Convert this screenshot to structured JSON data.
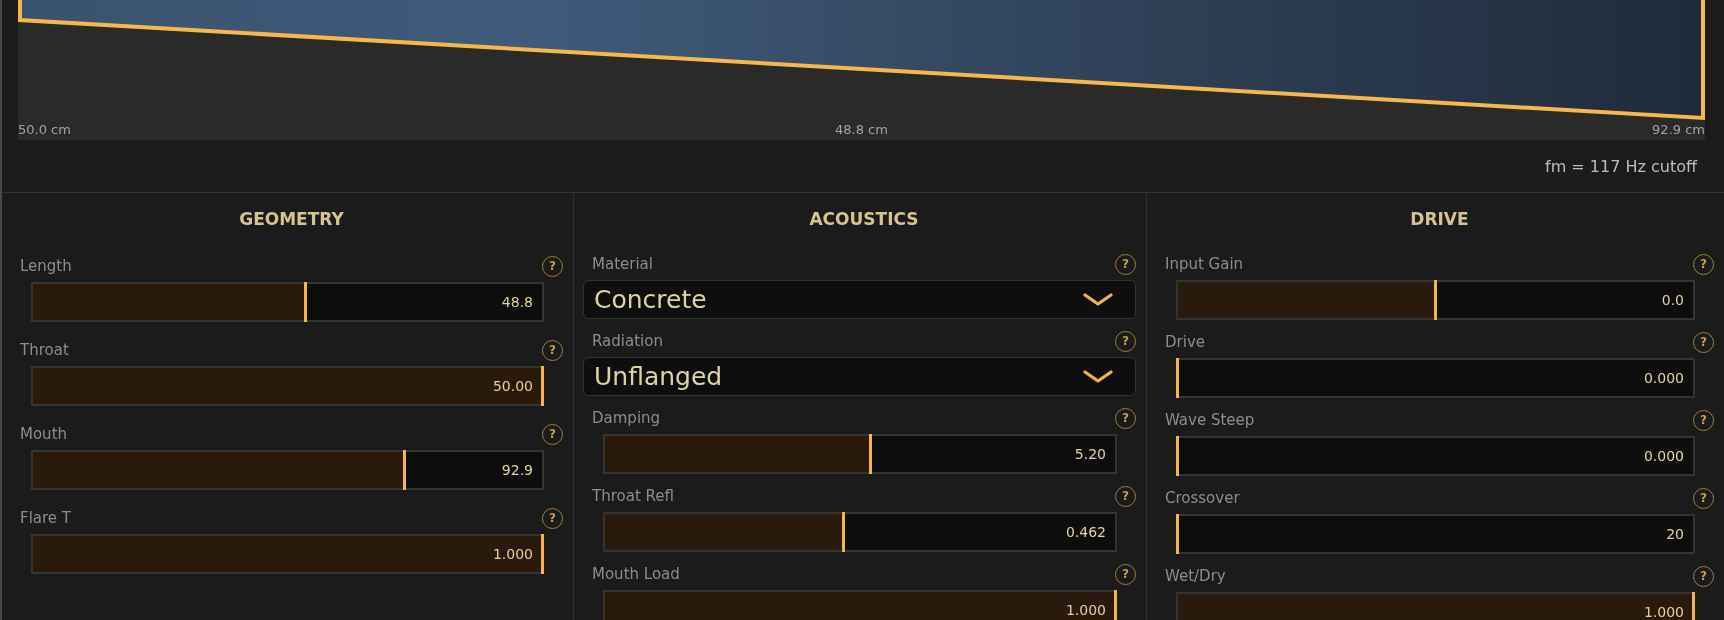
{
  "profile_plot": {
    "scale_labels": [
      "50.0 cm",
      "48.8 cm",
      "92.9 cm"
    ]
  },
  "cutoff_readout": "fm = 117 Hz cutoff",
  "sections": [
    {
      "title": "GEOMETRY",
      "controls": [
        {
          "kind": "slider",
          "label": "Length",
          "help": "?",
          "value": "48.8",
          "level": 0.536
        },
        {
          "kind": "slider",
          "label": "Throat",
          "help": "?",
          "value": "50.00",
          "level": 1
        },
        {
          "kind": "slider",
          "label": "Mouth",
          "help": "?",
          "value": "92.9",
          "level": 0.729
        },
        {
          "kind": "slider",
          "label": "Flare T",
          "help": "?",
          "value": "1.000",
          "level": 1
        }
      ]
    },
    {
      "title": "ACOUSTICS",
      "controls": [
        {
          "kind": "dropdown",
          "label": "Material",
          "help": "?",
          "value": "Concrete"
        },
        {
          "kind": "dropdown",
          "label": "Radiation",
          "help": "?",
          "value": "Unflanged"
        },
        {
          "kind": "slider",
          "label": "Damping",
          "help": "?",
          "value": "5.20",
          "level": 0.521
        },
        {
          "kind": "slider",
          "label": "Throat Refl",
          "help": "?",
          "value": "0.462",
          "level": 0.468
        },
        {
          "kind": "slider",
          "label": "Mouth Load",
          "help": "?",
          "value": "1.000",
          "level": 1
        }
      ]
    },
    {
      "title": "DRIVE",
      "controls": [
        {
          "kind": "slider",
          "label": "Input Gain",
          "help": "?",
          "value": "0.0",
          "level": 0.5
        },
        {
          "kind": "slider",
          "label": "Drive",
          "help": "?",
          "value": "0.000",
          "level": 0
        },
        {
          "kind": "slider",
          "label": "Wave Steep",
          "help": "?",
          "value": "0.000",
          "level": 0
        },
        {
          "kind": "slider",
          "label": "Crossover",
          "help": "?",
          "value": "20",
          "level": 0
        },
        {
          "kind": "slider",
          "label": "Wet/Dry",
          "help": "?",
          "value": "1.000",
          "level": 1
        }
      ]
    }
  ]
}
